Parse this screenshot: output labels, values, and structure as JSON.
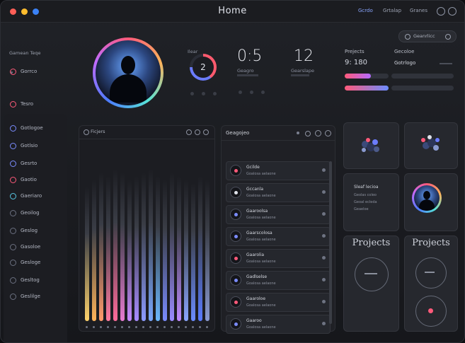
{
  "window": {
    "title": "Home",
    "dot_colors": [
      "#ff5f57",
      "#febc2e",
      "#3b82f6"
    ]
  },
  "nav": {
    "items": [
      "Gcrdo",
      "Grtalap",
      "Granes"
    ]
  },
  "top_pill": {
    "label": "Geanrlicc"
  },
  "sidebar": {
    "header": "Gamean Teqe",
    "items": [
      {
        "label": "Gorrco",
        "icon": "dot-icon",
        "color": "#ff5a7a"
      },
      {
        "label": "Tesro",
        "icon": "gear-icon",
        "color": "#ff5a7a"
      },
      {
        "label": "Gotlogoe",
        "icon": "gear-icon",
        "color": "#7b8cff"
      },
      {
        "label": "Gotlsio",
        "icon": "gear-icon",
        "color": "#7b8cff"
      },
      {
        "label": "Gesrto",
        "icon": "gear-icon",
        "color": "#7b8cff"
      },
      {
        "label": "Gaotio",
        "icon": "gear-icon",
        "color": "#ff5a7a"
      },
      {
        "label": "Gaeriaro",
        "icon": "gear-icon",
        "color": "#57c7e3"
      },
      {
        "label": "Geoilog",
        "icon": "gear-icon",
        "color": "#6b7080"
      },
      {
        "label": "Geslog",
        "icon": "gear-icon",
        "color": "#6b7080"
      },
      {
        "label": "Gasoloe",
        "icon": "gear-icon",
        "color": "#6b7080"
      },
      {
        "label": "Gesloge",
        "icon": "gear-icon",
        "color": "#6b7080"
      },
      {
        "label": "Gesltog",
        "icon": "gear-icon",
        "color": "#6b7080"
      },
      {
        "label": "Geslilge",
        "icon": "gear-icon",
        "color": "#6b7080"
      }
    ]
  },
  "stats": {
    "ring_label": "Ilear",
    "ring_value": "2",
    "metric_a": {
      "value": "0:5",
      "label": "Geagro"
    },
    "metric_b": {
      "value": "12",
      "label": "Gearslape"
    },
    "projects_label": "Prejects",
    "projects_value": "9: 180",
    "status_label": "Gecoloe",
    "status_value": "Gotrlogo"
  },
  "chart_panel": {
    "title": "Ficjers"
  },
  "list_panel": {
    "title": "Geagojeo",
    "rows": [
      {
        "t1": "Gcilde",
        "t2": "Goalosa aelaone",
        "color": "#ff5a7a"
      },
      {
        "t1": "Gccanla",
        "t2": "Goalosa aelaone",
        "color": "#dfe2ea"
      },
      {
        "t1": "Gaaroolsa",
        "t2": "Goalosa aelaone",
        "color": "#7b8cff"
      },
      {
        "t1": "Gaarscolosa",
        "t2": "Goalosa aelaone",
        "color": "#7b8cff"
      },
      {
        "t1": "Gaarolia",
        "t2": "Goalosa aelaone",
        "color": "#ff5a7a"
      },
      {
        "t1": "Gadlselse",
        "t2": "Goalosa aelaone",
        "color": "#7b8cff"
      },
      {
        "t1": "Gaaroloe",
        "t2": "Goalosa aelaone",
        "color": "#ff5a7a"
      },
      {
        "t1": "Gaaroo",
        "t2": "Goalosa aelaone",
        "color": "#7b8cff"
      }
    ]
  },
  "right_cards": {
    "info_title": "Sleaf lecioa",
    "info_lines": [
      "Geolas coleo",
      "Geoal ecleda",
      "Geaeloe"
    ],
    "project_a": "Projects",
    "project_b": "Projects"
  }
}
